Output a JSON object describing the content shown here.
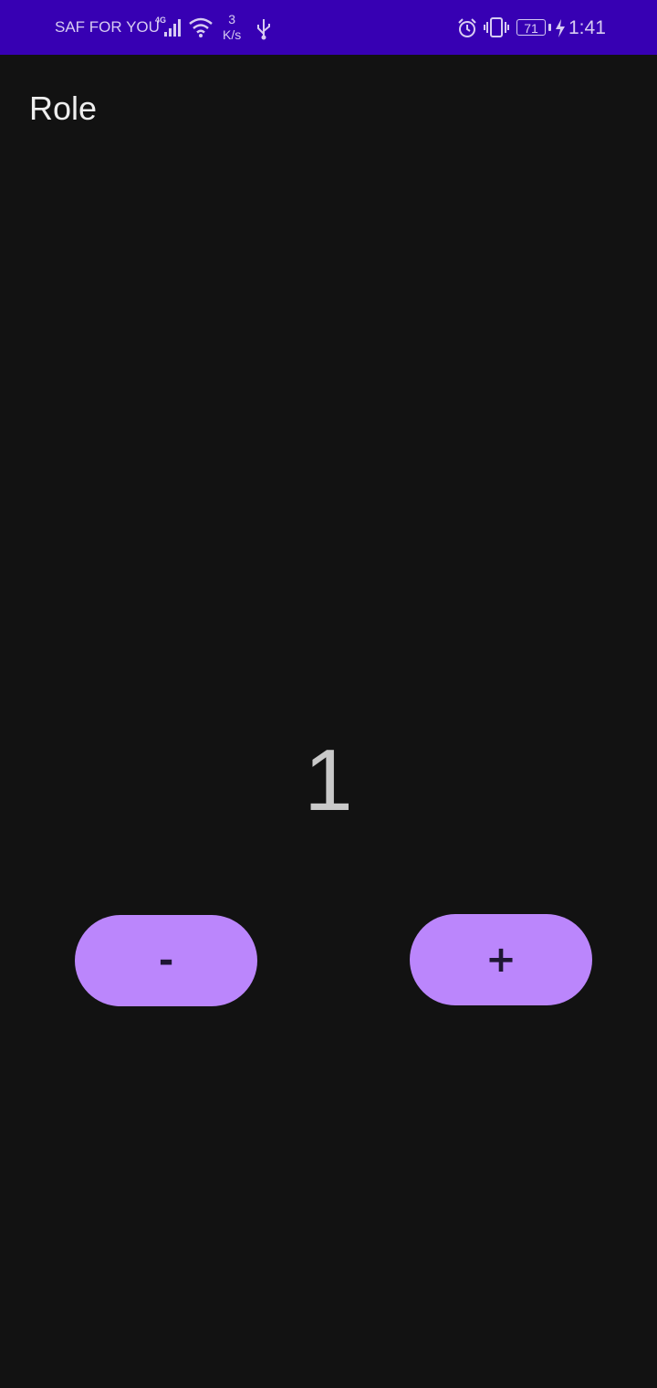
{
  "status_bar": {
    "carrier": "SAF FOR YOU",
    "network_type": "4G",
    "speed_value": "3",
    "speed_unit": "K/s",
    "battery": "71",
    "time": "1:41",
    "icons": [
      "signal-icon",
      "wifi-icon",
      "usb-icon",
      "alarm-icon",
      "vibrate-icon",
      "battery-icon",
      "charging-bolt-icon"
    ],
    "background_color": "#3700b3"
  },
  "app": {
    "title": "Role"
  },
  "counter": {
    "value": "1"
  },
  "buttons": {
    "decrement_label": "-",
    "increment_label": "+",
    "color": "#bb86fc"
  }
}
